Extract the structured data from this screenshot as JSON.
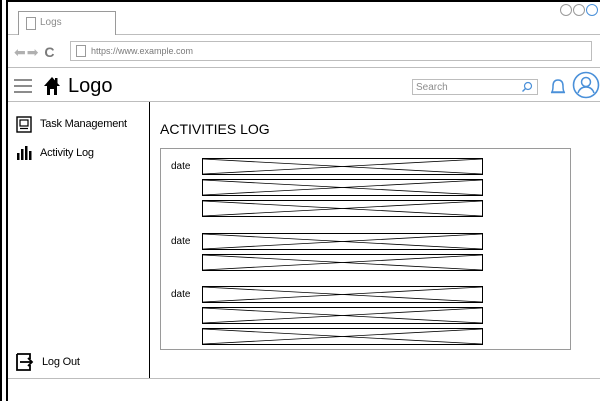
{
  "browser": {
    "tab_title": "Logs",
    "url": "https://www.example.com"
  },
  "header": {
    "logo": "Logo",
    "search_placeholder": "Search"
  },
  "sidebar": {
    "items": [
      {
        "label": "Task Management",
        "icon": "computer-icon"
      },
      {
        "label": "Activity Log",
        "icon": "bar-chart-icon"
      }
    ],
    "logout": {
      "label": "Log Out",
      "icon": "logout-icon"
    }
  },
  "main": {
    "title": "ACTIVITIES LOG",
    "groups": [
      {
        "date": "date",
        "entries": 3
      },
      {
        "date": "date",
        "entries": 2
      },
      {
        "date": "date",
        "entries": 3
      }
    ]
  },
  "colors": {
    "accent": "#4a90d9",
    "border": "#bdbdbd",
    "text": "#000000"
  }
}
